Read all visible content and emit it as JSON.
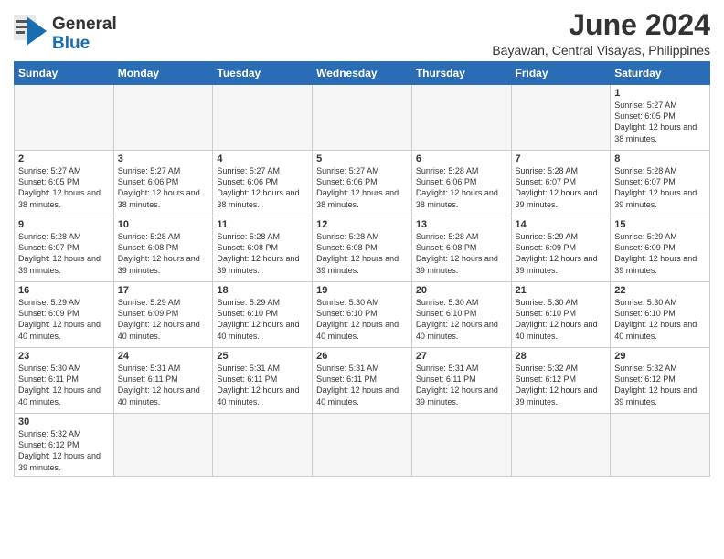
{
  "header": {
    "logo_line1": "General",
    "logo_line2": "Blue",
    "month_title": "June 2024",
    "subtitle": "Bayawan, Central Visayas, Philippines"
  },
  "weekdays": [
    "Sunday",
    "Monday",
    "Tuesday",
    "Wednesday",
    "Thursday",
    "Friday",
    "Saturday"
  ],
  "rows": [
    [
      {
        "day": "",
        "info": ""
      },
      {
        "day": "",
        "info": ""
      },
      {
        "day": "",
        "info": ""
      },
      {
        "day": "",
        "info": ""
      },
      {
        "day": "",
        "info": ""
      },
      {
        "day": "",
        "info": ""
      },
      {
        "day": "1",
        "info": "Sunrise: 5:27 AM\nSunset: 6:05 PM\nDaylight: 12 hours and 38 minutes."
      }
    ],
    [
      {
        "day": "2",
        "info": "Sunrise: 5:27 AM\nSunset: 6:05 PM\nDaylight: 12 hours and 38 minutes."
      },
      {
        "day": "3",
        "info": "Sunrise: 5:27 AM\nSunset: 6:06 PM\nDaylight: 12 hours and 38 minutes."
      },
      {
        "day": "4",
        "info": "Sunrise: 5:27 AM\nSunset: 6:06 PM\nDaylight: 12 hours and 38 minutes."
      },
      {
        "day": "5",
        "info": "Sunrise: 5:27 AM\nSunset: 6:06 PM\nDaylight: 12 hours and 38 minutes."
      },
      {
        "day": "6",
        "info": "Sunrise: 5:28 AM\nSunset: 6:06 PM\nDaylight: 12 hours and 38 minutes."
      },
      {
        "day": "7",
        "info": "Sunrise: 5:28 AM\nSunset: 6:07 PM\nDaylight: 12 hours and 39 minutes."
      },
      {
        "day": "8",
        "info": "Sunrise: 5:28 AM\nSunset: 6:07 PM\nDaylight: 12 hours and 39 minutes."
      }
    ],
    [
      {
        "day": "9",
        "info": "Sunrise: 5:28 AM\nSunset: 6:07 PM\nDaylight: 12 hours and 39 minutes."
      },
      {
        "day": "10",
        "info": "Sunrise: 5:28 AM\nSunset: 6:08 PM\nDaylight: 12 hours and 39 minutes."
      },
      {
        "day": "11",
        "info": "Sunrise: 5:28 AM\nSunset: 6:08 PM\nDaylight: 12 hours and 39 minutes."
      },
      {
        "day": "12",
        "info": "Sunrise: 5:28 AM\nSunset: 6:08 PM\nDaylight: 12 hours and 39 minutes."
      },
      {
        "day": "13",
        "info": "Sunrise: 5:28 AM\nSunset: 6:08 PM\nDaylight: 12 hours and 39 minutes."
      },
      {
        "day": "14",
        "info": "Sunrise: 5:29 AM\nSunset: 6:09 PM\nDaylight: 12 hours and 39 minutes."
      },
      {
        "day": "15",
        "info": "Sunrise: 5:29 AM\nSunset: 6:09 PM\nDaylight: 12 hours and 39 minutes."
      }
    ],
    [
      {
        "day": "16",
        "info": "Sunrise: 5:29 AM\nSunset: 6:09 PM\nDaylight: 12 hours and 40 minutes."
      },
      {
        "day": "17",
        "info": "Sunrise: 5:29 AM\nSunset: 6:09 PM\nDaylight: 12 hours and 40 minutes."
      },
      {
        "day": "18",
        "info": "Sunrise: 5:29 AM\nSunset: 6:10 PM\nDaylight: 12 hours and 40 minutes."
      },
      {
        "day": "19",
        "info": "Sunrise: 5:30 AM\nSunset: 6:10 PM\nDaylight: 12 hours and 40 minutes."
      },
      {
        "day": "20",
        "info": "Sunrise: 5:30 AM\nSunset: 6:10 PM\nDaylight: 12 hours and 40 minutes."
      },
      {
        "day": "21",
        "info": "Sunrise: 5:30 AM\nSunset: 6:10 PM\nDaylight: 12 hours and 40 minutes."
      },
      {
        "day": "22",
        "info": "Sunrise: 5:30 AM\nSunset: 6:10 PM\nDaylight: 12 hours and 40 minutes."
      }
    ],
    [
      {
        "day": "23",
        "info": "Sunrise: 5:30 AM\nSunset: 6:11 PM\nDaylight: 12 hours and 40 minutes."
      },
      {
        "day": "24",
        "info": "Sunrise: 5:31 AM\nSunset: 6:11 PM\nDaylight: 12 hours and 40 minutes."
      },
      {
        "day": "25",
        "info": "Sunrise: 5:31 AM\nSunset: 6:11 PM\nDaylight: 12 hours and 40 minutes."
      },
      {
        "day": "26",
        "info": "Sunrise: 5:31 AM\nSunset: 6:11 PM\nDaylight: 12 hours and 40 minutes."
      },
      {
        "day": "27",
        "info": "Sunrise: 5:31 AM\nSunset: 6:11 PM\nDaylight: 12 hours and 39 minutes."
      },
      {
        "day": "28",
        "info": "Sunrise: 5:32 AM\nSunset: 6:12 PM\nDaylight: 12 hours and 39 minutes."
      },
      {
        "day": "29",
        "info": "Sunrise: 5:32 AM\nSunset: 6:12 PM\nDaylight: 12 hours and 39 minutes."
      }
    ],
    [
      {
        "day": "30",
        "info": "Sunrise: 5:32 AM\nSunset: 6:12 PM\nDaylight: 12 hours and 39 minutes."
      },
      {
        "day": "",
        "info": ""
      },
      {
        "day": "",
        "info": ""
      },
      {
        "day": "",
        "info": ""
      },
      {
        "day": "",
        "info": ""
      },
      {
        "day": "",
        "info": ""
      },
      {
        "day": "",
        "info": ""
      }
    ]
  ]
}
